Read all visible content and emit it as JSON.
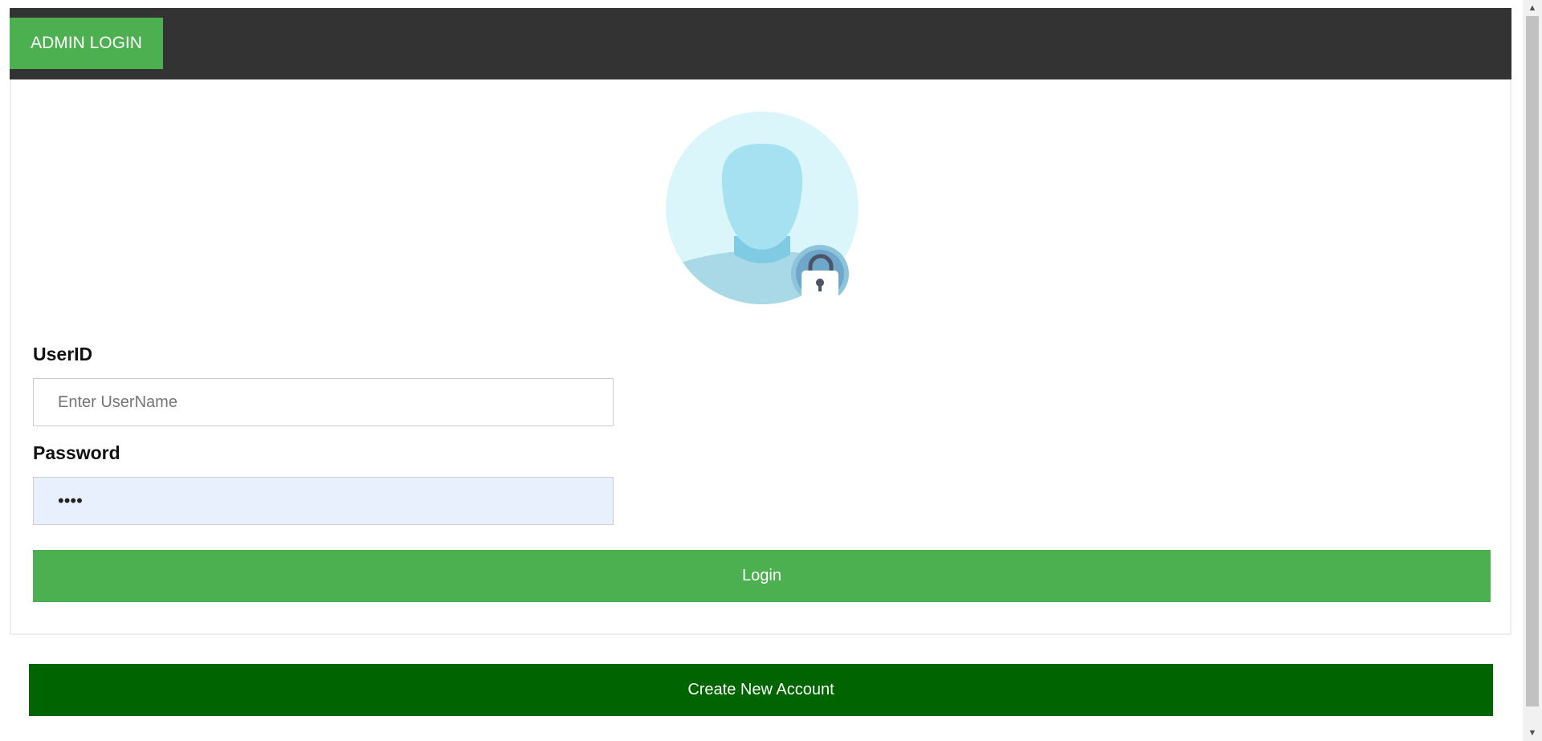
{
  "navbar": {
    "title": "ADMIN LOGIN"
  },
  "form": {
    "userid_label": "UserID",
    "userid_placeholder": "Enter UserName",
    "userid_value": "",
    "password_label": "Password",
    "password_value": "••••",
    "login_label": "Login"
  },
  "footer": {
    "create_account_label": "Create New Account"
  },
  "icons": {
    "avatar": "user-lock-avatar-icon",
    "scroll_up": "scroll-up-arrow-icon",
    "scroll_down": "scroll-down-arrow-icon"
  },
  "colors": {
    "navbar_bg": "#333333",
    "accent_green": "#4caf50",
    "dark_green": "#006400",
    "password_autofill_bg": "#e8f0fe"
  }
}
